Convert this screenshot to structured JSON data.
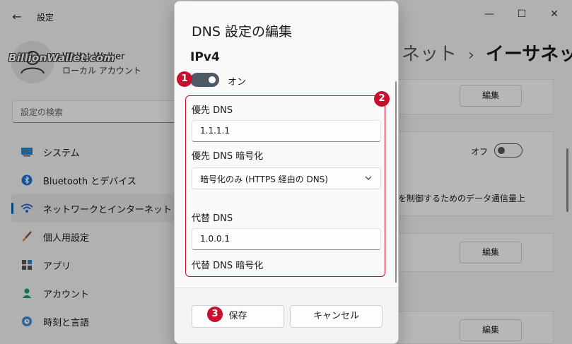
{
  "window": {
    "app_title": "設定",
    "user_name": "Wallet Walker",
    "user_type": "ローカル アカウント",
    "watermark": "BillionWallet.com",
    "search_placeholder": "設定の検索"
  },
  "sidebar": {
    "items": [
      {
        "label": "システム",
        "icon": "system-icon"
      },
      {
        "label": "Bluetooth とデバイス",
        "icon": "bluetooth-icon"
      },
      {
        "label": "ネットワークとインターネット",
        "icon": "network-icon",
        "active": true
      },
      {
        "label": "個人用設定",
        "icon": "personalization-icon"
      },
      {
        "label": "アプリ",
        "icon": "apps-icon"
      },
      {
        "label": "アカウント",
        "icon": "account-icon"
      },
      {
        "label": "時刻と言語",
        "icon": "time-language-icon"
      }
    ]
  },
  "main": {
    "breadcrumb_parent": "ネット",
    "breadcrumb_separator": "›",
    "breadcrumb_current": "イーサネット",
    "edit_label": "編集",
    "off_label": "オフ",
    "metered_text": "を制御するためのデータ通信量上"
  },
  "dialog": {
    "title": "DNS 設定の編集",
    "section": "IPv4",
    "toggle_label": "オン",
    "toggle_on": true,
    "preferred_dns_label": "優先 DNS",
    "preferred_dns_value": "1.1.1.1",
    "preferred_enc_label": "優先 DNS 暗号化",
    "preferred_enc_value": "暗号化のみ (HTTPS 経由の DNS)",
    "alternate_dns_label": "代替 DNS",
    "alternate_dns_value": "1.0.0.1",
    "alternate_enc_label": "代替 DNS 暗号化",
    "save_label": "保存",
    "cancel_label": "キャンセル"
  },
  "annotations": {
    "step1": "1",
    "step2": "2",
    "step3": "3",
    "color": "#c8102e"
  },
  "colors": {
    "accent": "#005fb8",
    "toggle_on": "#4d5a66"
  }
}
